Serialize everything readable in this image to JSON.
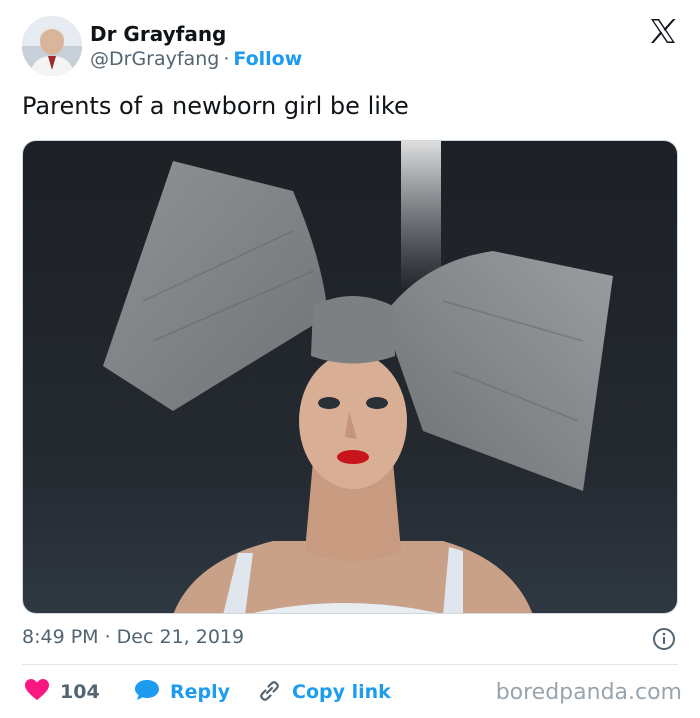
{
  "author": {
    "display_name": "Dr Grayfang",
    "handle": "@DrGrayfang",
    "separator": "·",
    "follow_label": "Follow"
  },
  "tweet": {
    "text": "Parents of a newborn girl be like",
    "timestamp": "8:49 PM · Dec 21, 2019"
  },
  "actions": {
    "likes_count": "104",
    "reply_label": "Reply",
    "copy_link_label": "Copy link"
  },
  "icons": {
    "platform": "x-logo-icon",
    "info": "info-icon",
    "like": "heart-icon",
    "reply": "speech-bubble-icon",
    "copy": "link-icon"
  },
  "colors": {
    "accent": "#1d9bf0",
    "like": "#f91880",
    "text_primary": "#0f1419",
    "text_secondary": "#536471",
    "divider": "#e1e8ed"
  },
  "watermark": "boredpanda.com"
}
